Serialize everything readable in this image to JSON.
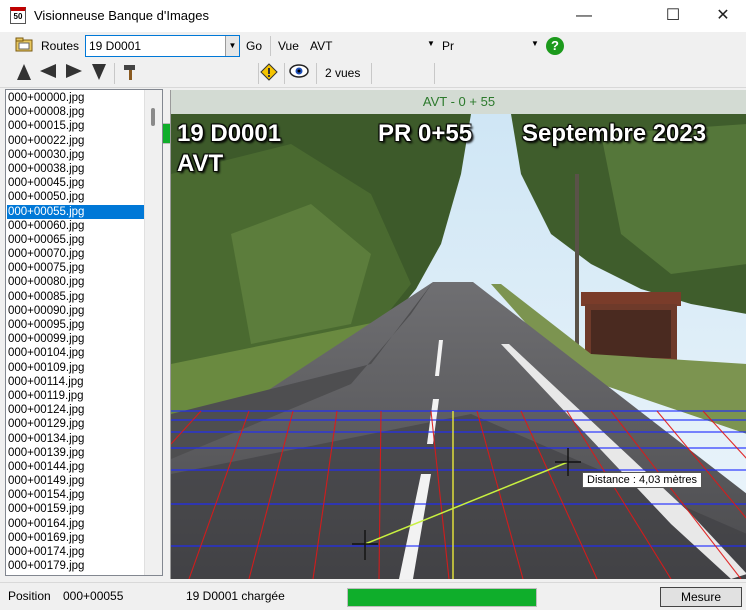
{
  "window": {
    "title": "Visionneuse Banque d'Images",
    "icon_text": "50",
    "minimize": "—",
    "maximize": "☐",
    "close": "✕"
  },
  "toolbar": {
    "routes_label": "Routes",
    "route_value": "19 D0001",
    "go_label": "Go",
    "vue_label": "Vue",
    "vue_value": "AVT",
    "pr_value": "Pr",
    "views_label": "2 vues",
    "progress_fraction": 0.25,
    "accent": "#0fae2b"
  },
  "file_list": {
    "selected_index": 8,
    "items": [
      "000+00000.jpg",
      "000+00008.jpg",
      "000+00015.jpg",
      "000+00022.jpg",
      "000+00030.jpg",
      "000+00038.jpg",
      "000+00045.jpg",
      "000+00050.jpg",
      "000+00055.jpg",
      "000+00060.jpg",
      "000+00065.jpg",
      "000+00070.jpg",
      "000+00075.jpg",
      "000+00080.jpg",
      "000+00085.jpg",
      "000+00090.jpg",
      "000+00095.jpg",
      "000+00099.jpg",
      "000+00104.jpg",
      "000+00109.jpg",
      "000+00114.jpg",
      "000+00119.jpg",
      "000+00124.jpg",
      "000+00129.jpg",
      "000+00134.jpg",
      "000+00139.jpg",
      "000+00144.jpg",
      "000+00149.jpg",
      "000+00154.jpg",
      "000+00159.jpg",
      "000+00164.jpg",
      "000+00169.jpg",
      "000+00174.jpg",
      "000+00179.jpg"
    ]
  },
  "viewer": {
    "header": "AVT - 0 + 55",
    "overlay_route": "19 D0001",
    "overlay_view": "AVT",
    "overlay_pr": "PR 0+55",
    "overlay_date": "Septembre 2023",
    "distance_label": "Distance : 4,03 mètres"
  },
  "status": {
    "position_label": "Position",
    "position_value": "000+00055",
    "loaded_text": "19 D0001 chargée",
    "progress_fraction": 1.0,
    "mesure_button": "Mesure"
  }
}
